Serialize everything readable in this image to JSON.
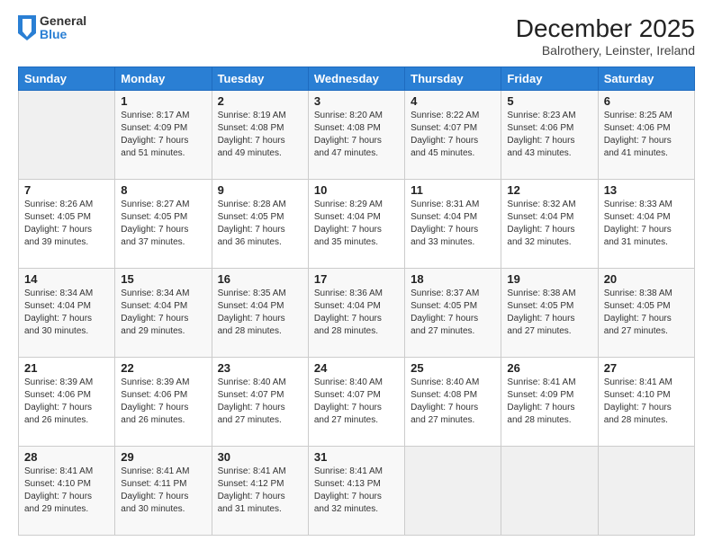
{
  "header": {
    "logo": {
      "general": "General",
      "blue": "Blue"
    },
    "title": "December 2025",
    "location": "Balrothery, Leinster, Ireland"
  },
  "days_of_week": [
    "Sunday",
    "Monday",
    "Tuesday",
    "Wednesday",
    "Thursday",
    "Friday",
    "Saturday"
  ],
  "weeks": [
    [
      {
        "day": "",
        "info": ""
      },
      {
        "day": "1",
        "info": "Sunrise: 8:17 AM\nSunset: 4:09 PM\nDaylight: 7 hours\nand 51 minutes."
      },
      {
        "day": "2",
        "info": "Sunrise: 8:19 AM\nSunset: 4:08 PM\nDaylight: 7 hours\nand 49 minutes."
      },
      {
        "day": "3",
        "info": "Sunrise: 8:20 AM\nSunset: 4:08 PM\nDaylight: 7 hours\nand 47 minutes."
      },
      {
        "day": "4",
        "info": "Sunrise: 8:22 AM\nSunset: 4:07 PM\nDaylight: 7 hours\nand 45 minutes."
      },
      {
        "day": "5",
        "info": "Sunrise: 8:23 AM\nSunset: 4:06 PM\nDaylight: 7 hours\nand 43 minutes."
      },
      {
        "day": "6",
        "info": "Sunrise: 8:25 AM\nSunset: 4:06 PM\nDaylight: 7 hours\nand 41 minutes."
      }
    ],
    [
      {
        "day": "7",
        "info": "Sunrise: 8:26 AM\nSunset: 4:05 PM\nDaylight: 7 hours\nand 39 minutes."
      },
      {
        "day": "8",
        "info": "Sunrise: 8:27 AM\nSunset: 4:05 PM\nDaylight: 7 hours\nand 37 minutes."
      },
      {
        "day": "9",
        "info": "Sunrise: 8:28 AM\nSunset: 4:05 PM\nDaylight: 7 hours\nand 36 minutes."
      },
      {
        "day": "10",
        "info": "Sunrise: 8:29 AM\nSunset: 4:04 PM\nDaylight: 7 hours\nand 35 minutes."
      },
      {
        "day": "11",
        "info": "Sunrise: 8:31 AM\nSunset: 4:04 PM\nDaylight: 7 hours\nand 33 minutes."
      },
      {
        "day": "12",
        "info": "Sunrise: 8:32 AM\nSunset: 4:04 PM\nDaylight: 7 hours\nand 32 minutes."
      },
      {
        "day": "13",
        "info": "Sunrise: 8:33 AM\nSunset: 4:04 PM\nDaylight: 7 hours\nand 31 minutes."
      }
    ],
    [
      {
        "day": "14",
        "info": "Sunrise: 8:34 AM\nSunset: 4:04 PM\nDaylight: 7 hours\nand 30 minutes."
      },
      {
        "day": "15",
        "info": "Sunrise: 8:34 AM\nSunset: 4:04 PM\nDaylight: 7 hours\nand 29 minutes."
      },
      {
        "day": "16",
        "info": "Sunrise: 8:35 AM\nSunset: 4:04 PM\nDaylight: 7 hours\nand 28 minutes."
      },
      {
        "day": "17",
        "info": "Sunrise: 8:36 AM\nSunset: 4:04 PM\nDaylight: 7 hours\nand 28 minutes."
      },
      {
        "day": "18",
        "info": "Sunrise: 8:37 AM\nSunset: 4:05 PM\nDaylight: 7 hours\nand 27 minutes."
      },
      {
        "day": "19",
        "info": "Sunrise: 8:38 AM\nSunset: 4:05 PM\nDaylight: 7 hours\nand 27 minutes."
      },
      {
        "day": "20",
        "info": "Sunrise: 8:38 AM\nSunset: 4:05 PM\nDaylight: 7 hours\nand 27 minutes."
      }
    ],
    [
      {
        "day": "21",
        "info": "Sunrise: 8:39 AM\nSunset: 4:06 PM\nDaylight: 7 hours\nand 26 minutes."
      },
      {
        "day": "22",
        "info": "Sunrise: 8:39 AM\nSunset: 4:06 PM\nDaylight: 7 hours\nand 26 minutes."
      },
      {
        "day": "23",
        "info": "Sunrise: 8:40 AM\nSunset: 4:07 PM\nDaylight: 7 hours\nand 27 minutes."
      },
      {
        "day": "24",
        "info": "Sunrise: 8:40 AM\nSunset: 4:07 PM\nDaylight: 7 hours\nand 27 minutes."
      },
      {
        "day": "25",
        "info": "Sunrise: 8:40 AM\nSunset: 4:08 PM\nDaylight: 7 hours\nand 27 minutes."
      },
      {
        "day": "26",
        "info": "Sunrise: 8:41 AM\nSunset: 4:09 PM\nDaylight: 7 hours\nand 28 minutes."
      },
      {
        "day": "27",
        "info": "Sunrise: 8:41 AM\nSunset: 4:10 PM\nDaylight: 7 hours\nand 28 minutes."
      }
    ],
    [
      {
        "day": "28",
        "info": "Sunrise: 8:41 AM\nSunset: 4:10 PM\nDaylight: 7 hours\nand 29 minutes."
      },
      {
        "day": "29",
        "info": "Sunrise: 8:41 AM\nSunset: 4:11 PM\nDaylight: 7 hours\nand 30 minutes."
      },
      {
        "day": "30",
        "info": "Sunrise: 8:41 AM\nSunset: 4:12 PM\nDaylight: 7 hours\nand 31 minutes."
      },
      {
        "day": "31",
        "info": "Sunrise: 8:41 AM\nSunset: 4:13 PM\nDaylight: 7 hours\nand 32 minutes."
      },
      {
        "day": "",
        "info": ""
      },
      {
        "day": "",
        "info": ""
      },
      {
        "day": "",
        "info": ""
      }
    ]
  ]
}
